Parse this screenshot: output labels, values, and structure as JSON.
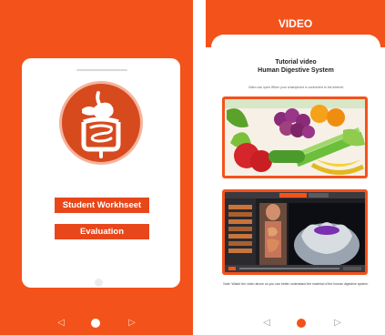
{
  "left_screen": {
    "logo_icon": "digestive-system-icon",
    "buttons": {
      "worksheet_label": "Student Workhseet",
      "evaluation_label": "Evaluation"
    },
    "nav": {
      "back": "◁",
      "recent": "▷"
    }
  },
  "right_screen": {
    "header_title": "VIDEO",
    "tutorial_title": "Tutorial video",
    "tutorial_subtitle": "Human Digestive System",
    "note_top": "Video can open When your smartphone is connected to the internet",
    "video_1": {
      "icon": "fruits-vegetables-thumbnail"
    },
    "video_2": {
      "icon": "tooth-digestive-animation-thumbnail"
    },
    "note_bottom": "Note: Watch the video above so you can better understand the material of the human digestive system.",
    "nav": {
      "back": "◁",
      "recent": "▷"
    }
  },
  "colors": {
    "brand_orange": "#f4521b",
    "button_orange": "#e8471b",
    "white": "#ffffff"
  }
}
